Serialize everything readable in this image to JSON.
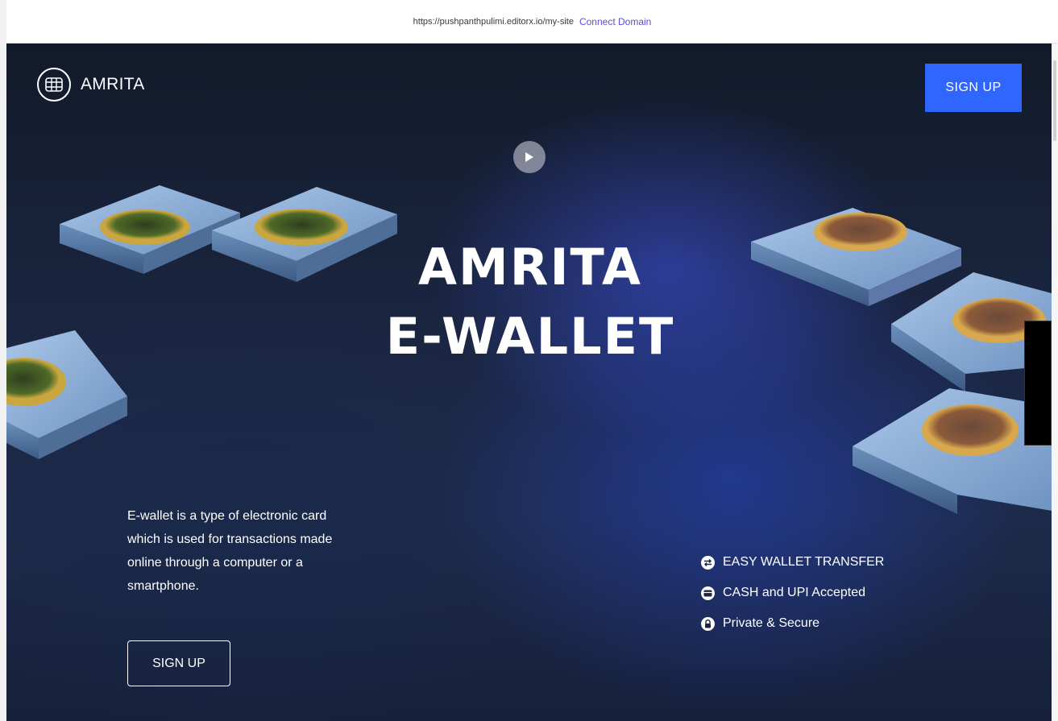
{
  "topbar": {
    "url": "https://pushpanthpulimi.editorx.io/my-site",
    "connect_label": "Connect Domain"
  },
  "header": {
    "brand": "AMRITA",
    "signup_label": "SIGN UP"
  },
  "hero": {
    "title_line1": "AMRITA",
    "title_line2": "E-WALLET",
    "description": "E-wallet is a type of electronic card which is used for transactions made online through a computer or a smartphone.",
    "cta_label": "SIGN UP"
  },
  "features": [
    {
      "label": "EASY WALLET TRANSFER",
      "icon": "transfer-icon"
    },
    {
      "label": "CASH and UPI Accepted",
      "icon": "cash-icon"
    },
    {
      "label": "Private & Secure",
      "icon": "lock-icon"
    }
  ],
  "colors": {
    "accent": "#2f66ff",
    "link": "#5a4ed8",
    "background": "#1a2540",
    "text": "#ffffff"
  }
}
